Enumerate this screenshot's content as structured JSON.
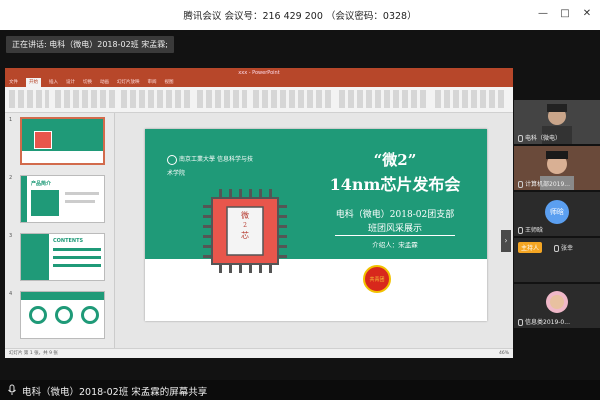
{
  "window": {
    "title": "腾讯会议 会议号：216 429 200 （会议密码：0328）",
    "controls": [
      "minimize",
      "maximize",
      "close"
    ]
  },
  "stage": {
    "speaking_label": "正在讲话: 电科（微电）2018-02班 宋孟霖;"
  },
  "ppt": {
    "title": "xxx - PowerPoint",
    "tabs": [
      "文件",
      "开始",
      "插入",
      "设计",
      "切换",
      "动画",
      "幻灯片放映",
      "审阅",
      "视图"
    ],
    "thumbnail_numbers": [
      "1",
      "2",
      "3",
      "4"
    ],
    "thumbnails": {
      "t2_title": "产品简介",
      "t3_title": "CONTENTS"
    },
    "status_left": "幻灯片 第 1 张，共 9 张",
    "zoom": "46%"
  },
  "slide": {
    "university": "南京工業大學",
    "school": "信息科学与技术学院",
    "chip_glyph_top": "微",
    "chip_glyph_mid": "2",
    "chip_glyph_bottom": "芯",
    "title_line1": "“微2”",
    "title_line2": "14nm芯片发布会",
    "subtitle_line1": "电科（微电）2018-02团支部",
    "subtitle_line2": "班团风采展示",
    "presenter": "介绍人：宋孟霖",
    "emblem_text": "共青团"
  },
  "participants": [
    {
      "label": "电科（微电）"
    },
    {
      "label": "计算机部2019..."
    },
    {
      "avatar": "师晗",
      "label": "王师晗"
    },
    {
      "host_badge": "主持人",
      "label": "张幸"
    },
    {
      "label": "信息类2019-0..."
    }
  ],
  "bottombar": {
    "sharing_text": "电科（微电）2018-02班 宋孟霖的屏幕共享"
  },
  "colors": {
    "slide_green": "#1f9a78",
    "ppt_red": "#b7472a",
    "chip_red": "#e8564c"
  }
}
